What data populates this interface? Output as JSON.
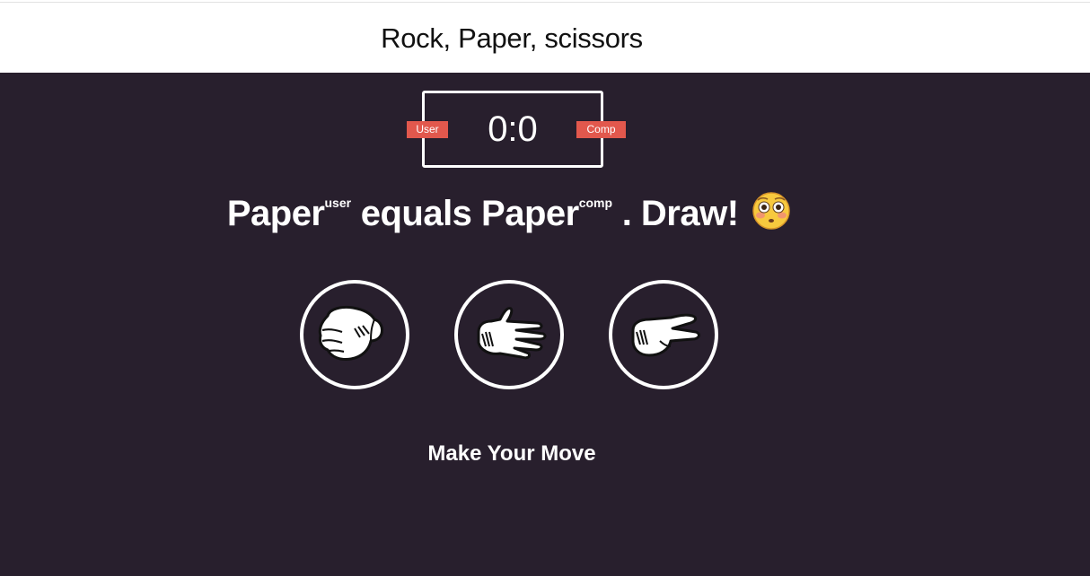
{
  "header": {
    "title": "Rock, Paper, scissors"
  },
  "scoreboard": {
    "score": "0:0",
    "user_label": "User",
    "comp_label": "Comp"
  },
  "result": {
    "user_choice": "Paper",
    "user_tag": "user",
    "verb": "equals",
    "comp_choice": "Paper",
    "comp_tag": "comp",
    "outcome": ". Draw!",
    "emoji_icon": "flushed-face-icon"
  },
  "choices": [
    {
      "id": "rock",
      "icon": "rock-hand-icon"
    },
    {
      "id": "paper",
      "icon": "paper-hand-icon"
    },
    {
      "id": "scissors",
      "icon": "scissors-hand-icon"
    }
  ],
  "prompt": "Make Your Move",
  "colors": {
    "background": "#281f2d",
    "badge": "#e2584d",
    "header_bg": "#ffffff"
  }
}
